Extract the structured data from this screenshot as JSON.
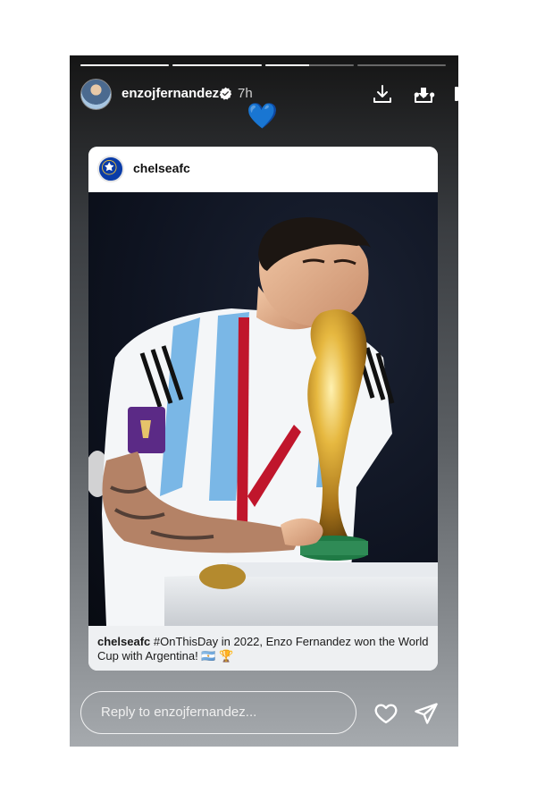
{
  "story": {
    "progress": [
      1.0,
      1.0,
      0.5,
      0.0
    ],
    "user": {
      "username": "enzojfernandez",
      "verified": true,
      "time": "7h",
      "avatar_icon": "avatar-photo"
    },
    "reaction_emoji": "💙",
    "header_icons": [
      "download-icon",
      "save-icon",
      "pause-icon",
      "more-icon"
    ],
    "shared_post": {
      "account": "chelseafc",
      "account_logo": "chelsea-crest",
      "caption_user": "chelseafc",
      "caption_text": "#OnThisDay in 2022, Enzo Fernandez won the World Cup with Argentina! 🇦🇷 🏆",
      "photo_subject": "player-kissing-trophy"
    },
    "reply": {
      "placeholder": "Reply to enzojfernandez..."
    },
    "footer_icons": [
      "heart-icon",
      "send-icon"
    ]
  },
  "colors": {
    "verified": "#3897f0",
    "chelsea_blue": "#0a3ca8",
    "trophy_gold": "#d9a52c"
  }
}
